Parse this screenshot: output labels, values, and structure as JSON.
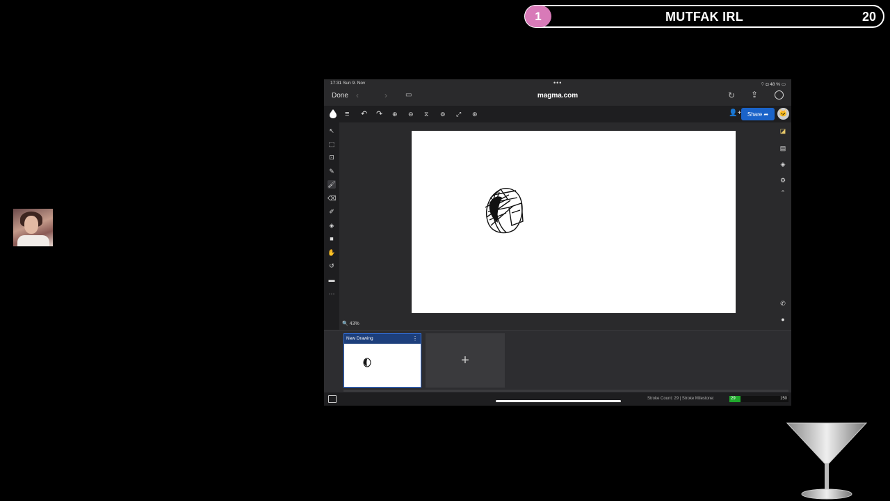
{
  "banner": {
    "rank": "1",
    "title": "MUTFAK IRL",
    "count": "20"
  },
  "ipad_status": {
    "time": "17:31  Sun 9. Nov",
    "dots": "•••",
    "right": "⌔ ◘ 48 % ▭"
  },
  "safari": {
    "done": "Done",
    "back": "‹",
    "forward": "›",
    "tabs_icon": "▭",
    "url": "magma.com",
    "reload": "↻",
    "share": "⇪"
  },
  "app_toolbar": {
    "share_label": "Share ➦",
    "menu": "≡",
    "undo": "↶",
    "redo": "↷",
    "zoom_in": "⊕",
    "zoom_out": "⊖",
    "tool_a": "⧖",
    "tool_b": "⊚",
    "expand": "⤢",
    "tool_c": "⊛",
    "add_user": "👤+",
    "avatar": "🐱"
  },
  "left_tools": [
    "↖",
    "⬚",
    "⊡",
    "✎",
    "🖌",
    "⌫",
    "✐",
    "◈",
    "■",
    "✋",
    "↺",
    "▬",
    "⋯"
  ],
  "right_tools": [
    "◪",
    "▤",
    "◈",
    "⚙",
    "⌃"
  ],
  "right_lower_tools": [
    "✆",
    "●"
  ],
  "zoom": {
    "icon": "🔍",
    "value": "43%"
  },
  "pages": {
    "current_name": "New Drawing",
    "kebab": "⋮",
    "add": "+"
  },
  "bottom": {
    "stroke_count_label": "Stroke Count: 29  |  Stroke Milestone:",
    "milestone_value": "29",
    "milestone_max": "150",
    "milestone_progress": 0.19
  },
  "colors": {
    "banner_badge": "#d87ab8",
    "share_blue": "#1a63c9",
    "page_border": "#2f6fe0",
    "milestone_green": "#1fa82c"
  }
}
